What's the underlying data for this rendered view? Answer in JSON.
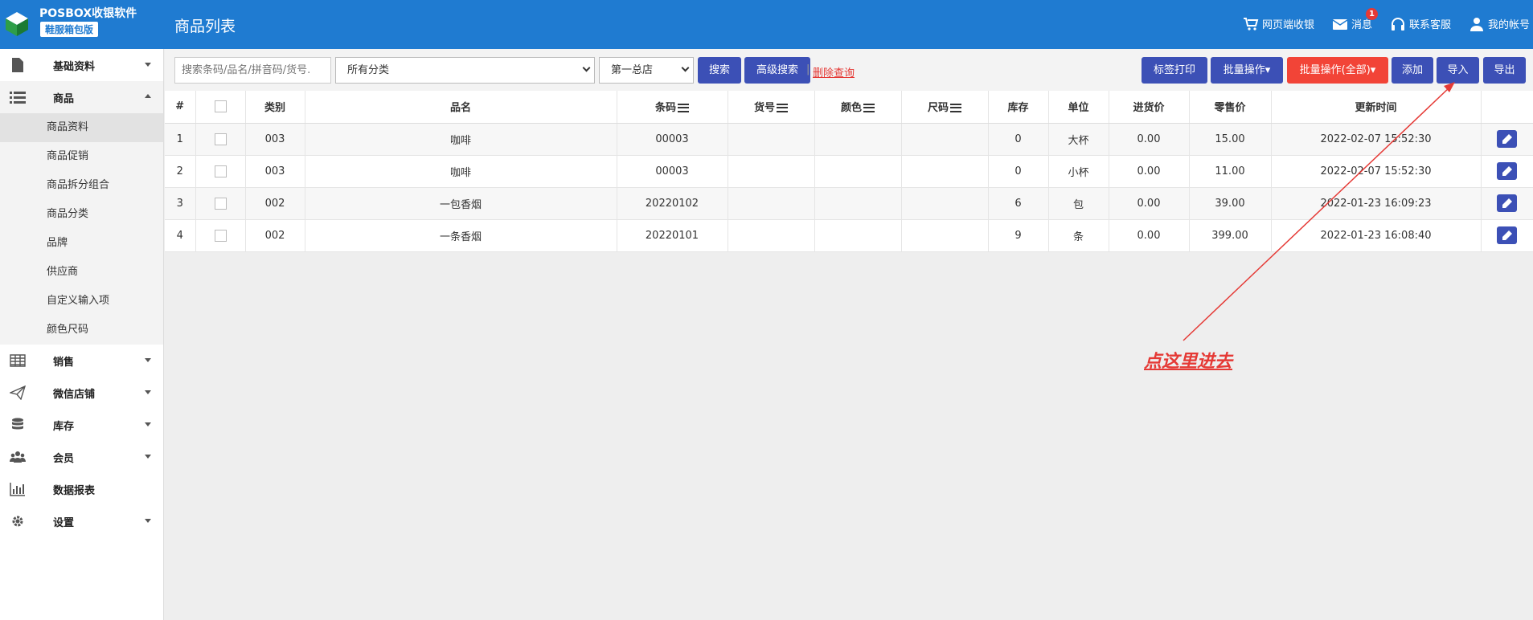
{
  "header": {
    "brand": "POSBOX收银软件",
    "edition": "鞋服箱包版",
    "page_title": "商品列表",
    "nav": {
      "web_pos": "网页端收银",
      "messages": "消息",
      "message_count": "1",
      "support": "联系客服",
      "account": "我的帐号"
    }
  },
  "sidebar": {
    "basic": "基础资料",
    "goods": "商品",
    "goods_sub": [
      "商品资料",
      "商品促销",
      "商品拆分组合",
      "商品分类",
      "品牌",
      "供应商",
      "自定义输入项",
      "颜色尺码"
    ],
    "sales": "销售",
    "wechat": "微信店铺",
    "stock": "库存",
    "member": "会员",
    "report": "数据报表",
    "settings": "设置"
  },
  "toolbar": {
    "search_placeholder": "搜索条码/品名/拼音码/货号.",
    "category_select": "所有分类",
    "store_select": "第一总店",
    "search_btn": "搜索",
    "advanced_btn": "高级搜索",
    "separator": "|",
    "delete_query": "删除查询",
    "label_print": "标签打印",
    "batch_op": "批量操作▾",
    "batch_op_all": "批量操作(全部)▾",
    "add": "添加",
    "import": "导入",
    "export": "导出"
  },
  "table": {
    "headers": {
      "idx": "#",
      "category": "类别",
      "name": "品名",
      "barcode": "条码",
      "sku": "货号",
      "color": "颜色",
      "size": "尺码",
      "stock": "库存",
      "unit": "单位",
      "cost": "进货价",
      "retail": "零售价",
      "updated": "更新时间"
    },
    "rows": [
      {
        "idx": "1",
        "category": "003",
        "name": "咖啡",
        "barcode": "00003",
        "sku": "",
        "color": "",
        "size": "",
        "stock": "0",
        "unit": "大杯",
        "cost": "0.00",
        "retail": "15.00",
        "updated": "2022-02-07 15:52:30"
      },
      {
        "idx": "2",
        "category": "003",
        "name": "咖啡",
        "barcode": "00003",
        "sku": "",
        "color": "",
        "size": "",
        "stock": "0",
        "unit": "小杯",
        "cost": "0.00",
        "retail": "11.00",
        "updated": "2022-02-07 15:52:30"
      },
      {
        "idx": "3",
        "category": "002",
        "name": "一包香烟",
        "barcode": "20220102",
        "sku": "",
        "color": "",
        "size": "",
        "stock": "6",
        "unit": "包",
        "cost": "0.00",
        "retail": "39.00",
        "updated": "2022-01-23 16:09:23"
      },
      {
        "idx": "4",
        "category": "002",
        "name": "一条香烟",
        "barcode": "20220101",
        "sku": "",
        "color": "",
        "size": "",
        "stock": "9",
        "unit": "条",
        "cost": "0.00",
        "retail": "399.00",
        "updated": "2022-01-23 16:08:40"
      }
    ]
  },
  "annotation": {
    "text": "点这里进去",
    "color": "#e53935"
  }
}
